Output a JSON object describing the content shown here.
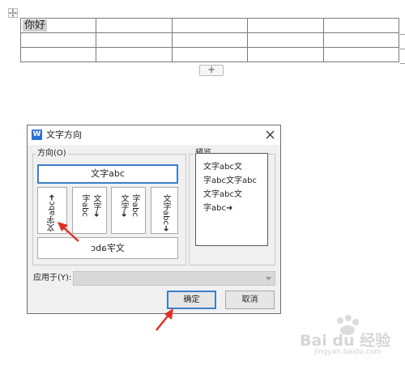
{
  "document": {
    "table": {
      "rows": [
        [
          "你好",
          "",
          "",
          "",
          ""
        ],
        [
          "",
          "",
          "",
          "",
          ""
        ],
        [
          "",
          "",
          "",
          "",
          ""
        ]
      ]
    },
    "add_row_label": "+"
  },
  "dialog": {
    "title": "文字方向",
    "icon_letter": "W",
    "direction_group": {
      "label": "方向(O)",
      "options": {
        "horizontal": "文字abc",
        "vertical_rotated_left": "文字abc➜",
        "vertical_stacked_a": "文字abc➜",
        "vertical_stacked_b": "文字abc➜",
        "vertical_rotated_right": "文字abc➜",
        "horizontal_flipped": "文字abc"
      },
      "stacked_columns": {
        "a": [
          "文字➜",
          "字abc"
        ],
        "b": [
          "文字➜",
          "字abc"
        ]
      }
    },
    "preview_group": {
      "label": "预览",
      "lines": [
        "文字abc文",
        "字abc文字abc",
        "文字abc文",
        "字abc➜"
      ]
    },
    "apply_to": {
      "label": "应用于(Y):",
      "value": ""
    },
    "buttons": {
      "ok": "确定",
      "cancel": "取消"
    }
  },
  "colors": {
    "selection": "#3c7fc8",
    "arrow": "#e03025",
    "dialog_bg": "#f0f0f0"
  },
  "watermark": {
    "text": "Bai du 经验",
    "sub": "jingyan.baidu.com"
  }
}
